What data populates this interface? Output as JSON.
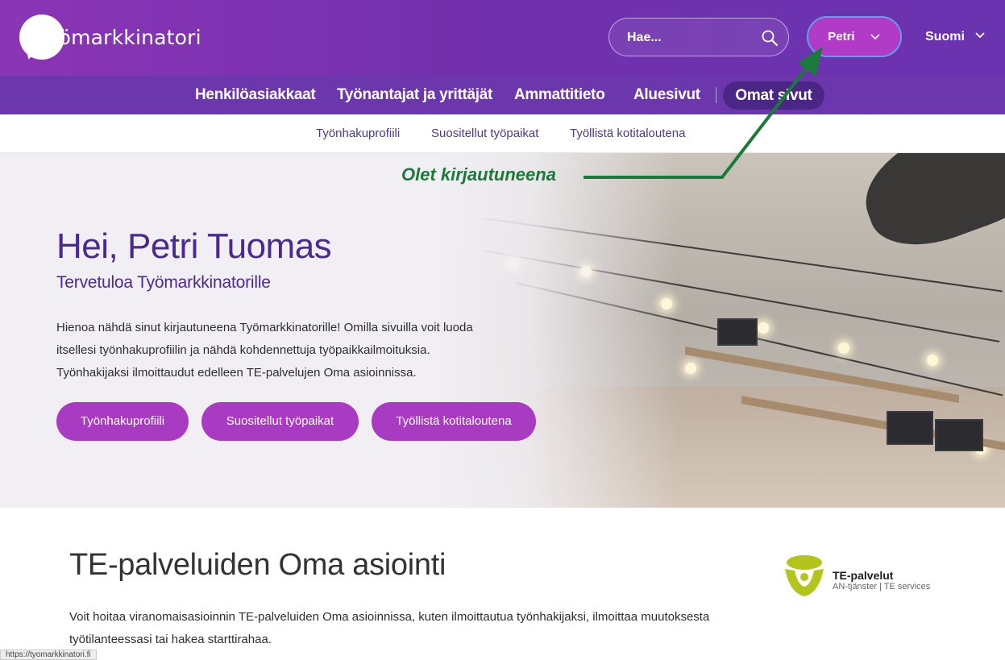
{
  "header": {
    "logo_text": "Työmarkkinatori",
    "search": {
      "placeholder": "Hae..."
    },
    "user_button_label": "Petri",
    "language_label": "Suomi"
  },
  "main_nav": {
    "items": [
      "Henkilöasiakkaat",
      "Työnantajat ja yrittäjät",
      "Ammattitieto",
      "Aluesivut"
    ],
    "active": "Omat sivut"
  },
  "sub_nav": {
    "items": [
      "Työnhakuprofiili",
      "Suositellut työpaikat",
      "Työllistä kotitaloutena"
    ]
  },
  "hero": {
    "title": "Hei, Petri Tuomas",
    "subtitle": "Tervetuloa Työmarkkinatorille",
    "text": "Hienoa nähdä sinut kirjautuneena Työmarkkinatorille! Omilla sivuilla voit luoda itsellesi työnhakuprofiilin ja nähdä kohdennettuja työpaikkailmoituksia. Työnhakijaksi ilmoittaudut edelleen TE-palvelujen Oma asioinnissa.",
    "buttons": [
      "Työnhakuprofiili",
      "Suositellut työpaikat",
      "Työllistä kotitaloutena"
    ]
  },
  "annotation": {
    "text": "Olet kirjautuneena",
    "color": "#1a7a3a"
  },
  "section": {
    "title": "TE-palveluiden Oma asiointi",
    "text": "Voit hoitaa viranomaisasioinnin TE-palveluiden Oma asioinnissa, kuten ilmoittautua työnhakijaksi, ilmoittaa muutoksesta työtilanteessasi tai hakea starttirahaa."
  },
  "te_logo": {
    "name": "TE-palvelut",
    "tagline": "AN-tjänster | TE services"
  },
  "status_url": "https://tyomarkkinatori.fi",
  "colors": {
    "header": "#7230ad",
    "nav": "#6c37ad",
    "active_pill": "#4a2784",
    "accent": "#a93bc2",
    "user_button": "#b13ac6",
    "title": "#4b2a8f"
  }
}
